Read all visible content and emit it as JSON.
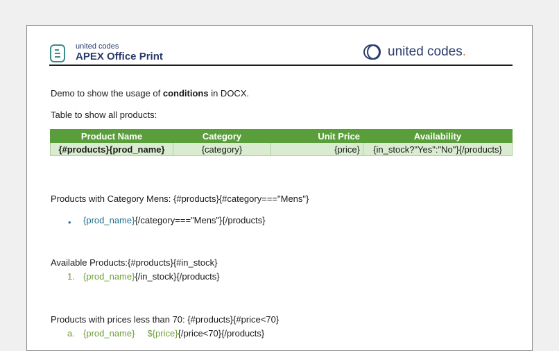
{
  "header": {
    "brand_small": "united codes",
    "brand_big": "APEX Office Print",
    "right_brand": "united codes",
    "right_brand_dot": "."
  },
  "intro": {
    "prefix": "Demo to show the usage of ",
    "bold": "conditions",
    "suffix": " in DOCX."
  },
  "table_intro": "Table to show all products:",
  "table": {
    "headers": [
      "Product Name",
      "Category",
      "Unit Price",
      "Availability"
    ],
    "row": [
      "{#products}{prod_name}",
      "{category}",
      "{price}",
      "{in_stock?\"Yes\":\"No\"}{/products}"
    ]
  },
  "mens": {
    "heading": "Products with Category Mens: {#products}{#category===\"Mens\"}",
    "bullet": "•",
    "item_field": "{prod_name}",
    "item_rest": "{/category===\"Mens\"}{/products}"
  },
  "available": {
    "heading": "Available Products:{#products}{#in_stock}",
    "marker": "1.",
    "item_field": "{prod_name}",
    "item_rest": "{/in_stock}{/products}"
  },
  "prices": {
    "heading": "Products with prices less than 70: {#products}{#price<70}",
    "marker": "a.",
    "item_field": "{prod_name}",
    "item_price": "${price}",
    "item_rest": "{/price<70}{/products}"
  },
  "colors": {
    "table_header": "#5a9e3c",
    "table_row": "#d9ecd0",
    "brand_navy": "#2a3a6b",
    "field_teal": "#1f6f8b",
    "field_olive": "#6f9d3a"
  }
}
